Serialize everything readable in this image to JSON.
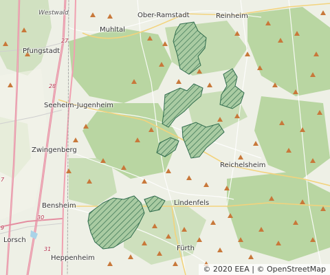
{
  "map": {
    "towns": [
      {
        "id": "westwald",
        "label": "Westwald",
        "italic": true
      },
      {
        "id": "ober-ramstadt",
        "label": "Ober-Ramstadt"
      },
      {
        "id": "reinheim",
        "label": "Reinheim"
      },
      {
        "id": "muhltal",
        "label": "Muhltal"
      },
      {
        "id": "pfungstadt",
        "label": "Pfungstadt"
      },
      {
        "id": "seeheim-jugenheim",
        "label": "Seeheim-Jugenheim"
      },
      {
        "id": "zwingenberg",
        "label": "Zwingenberg"
      },
      {
        "id": "reichelsheim",
        "label": "Reichelsheim"
      },
      {
        "id": "bensheim",
        "label": "Bensheim"
      },
      {
        "id": "lindenfels",
        "label": "Lindenfels"
      },
      {
        "id": "lorsch",
        "label": "Lorsch"
      },
      {
        "id": "heppenheim",
        "label": "Heppenheim"
      },
      {
        "id": "furth",
        "label": "Fürth"
      }
    ],
    "road_numbers": [
      "27",
      "28",
      "30",
      "31",
      "7",
      "9"
    ],
    "layers": {
      "protected_area_fill": "#9ec49a",
      "protected_area_hatch": "#2f6b4c",
      "peak_marker_color": "#c8783a",
      "forest_color": "#b5d39f",
      "motorway_color": "#e48da0"
    },
    "attribution": {
      "eea": "© 2020 EEA",
      "separator": "|",
      "osm": "© OpenStreetMap"
    }
  }
}
